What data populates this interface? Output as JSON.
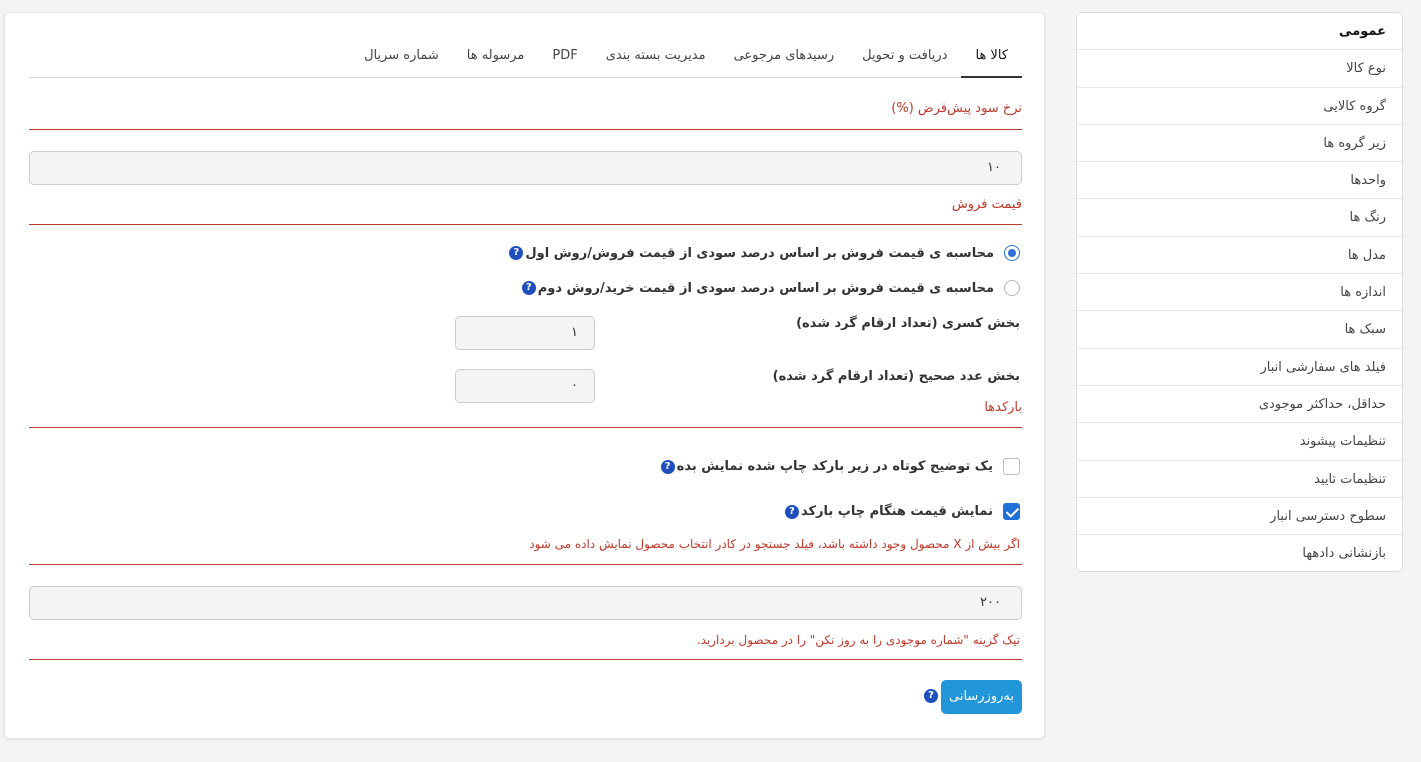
{
  "sidebar": {
    "items": [
      {
        "label": "عمومی"
      },
      {
        "label": "نوع کالا"
      },
      {
        "label": "گروه کالایی"
      },
      {
        "label": "زیر گروه ها"
      },
      {
        "label": "واحدها"
      },
      {
        "label": "رنگ ها"
      },
      {
        "label": "مدل ها"
      },
      {
        "label": "اندازه ها"
      },
      {
        "label": "سبک ها"
      },
      {
        "label": "فیلد های سفارشی انبار"
      },
      {
        "label": "حداقل، حداکثر موجودی"
      },
      {
        "label": "تنظیمات پیشوند"
      },
      {
        "label": "تنظیمات تایید"
      },
      {
        "label": "سطوح دسترسی انبار"
      },
      {
        "label": "بازنشانی دادهها"
      }
    ]
  },
  "tabs": [
    {
      "label": "کالا ها"
    },
    {
      "label": "دریافت و تحویل"
    },
    {
      "label": "رسیدهای مرجوعی"
    },
    {
      "label": "مدیریت بسته بندی"
    },
    {
      "label": "PDF"
    },
    {
      "label": "مرسوله ها"
    },
    {
      "label": "شماره سریال"
    }
  ],
  "profit": {
    "title": "نرخ سود پیش‌فرض (%)",
    "value": "۱۰"
  },
  "sale_price": {
    "title": "قیمت فروش",
    "option1": "محاسبه ی قیمت فروش بر اساس درصد سودی از قیمت فروش/روش اول",
    "option2": "محاسبه ی قیمت فروش بر اساس درصد سودی از قیمت خرید/روش دوم",
    "decimal_label": "بخش کسری (تعداد ارقام گرد شده)",
    "decimal_value": "۱",
    "integer_label": "بخش عدد صحیح (تعداد ارقام گرد شده)",
    "integer_value": "۰"
  },
  "barcodes": {
    "title": "بارکدها",
    "short_desc_label": "یک توضیح کوتاه در زیر بارکد چاپ شده نمایش بده",
    "show_price_label": "نمایش قیمت هنگام چاپ بارکد"
  },
  "search_threshold": {
    "note": "اگر بیش از X محصول وجود داشته باشد، فیلد جستجو در کادر انتخاب محصول نمایش داده می شود",
    "value": "۲۰۰"
  },
  "stock_note": "تیک گزینه \"شماره موجودی را به روز نکن\" را در محصول بردارید.",
  "buttons": {
    "update": "به‌روزرسانی",
    "help": "?"
  },
  "colors": {
    "accent": "#2196d9",
    "section_red": "#c0392b",
    "help_blue": "#1f4fbf"
  }
}
